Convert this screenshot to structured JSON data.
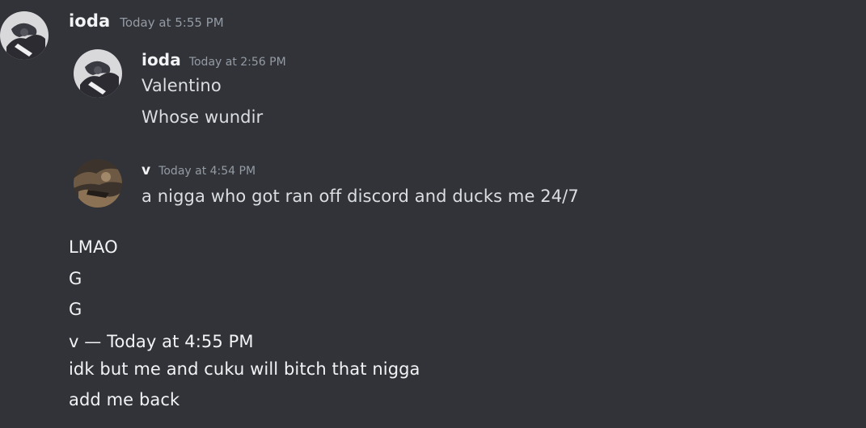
{
  "main_message": {
    "author": "ioda",
    "timestamp": "Today at 5:55 PM",
    "avatar_icon": "avatar-ioda-icon"
  },
  "forwarded": [
    {
      "author": "ioda",
      "timestamp": "Today at 2:56 PM",
      "avatar_icon": "avatar-ioda-icon",
      "lines": [
        "Valentino",
        "Whose wundir"
      ]
    },
    {
      "author": "v",
      "timestamp": "Today at 4:54 PM",
      "avatar_icon": "avatar-v-icon",
      "lines": [
        "a nigga who got ran off discord and ducks me 24/7"
      ]
    }
  ],
  "followups": [
    "LMAO",
    "G",
    "G",
    "v — Today at 4:55 PM",
    "idk but me and cuku will bitch that nigga",
    "add me back"
  ],
  "colors": {
    "background": "#313338",
    "username": "#f2f3f5",
    "timestamp": "#949ba4",
    "message_text": "#dbdee1"
  }
}
